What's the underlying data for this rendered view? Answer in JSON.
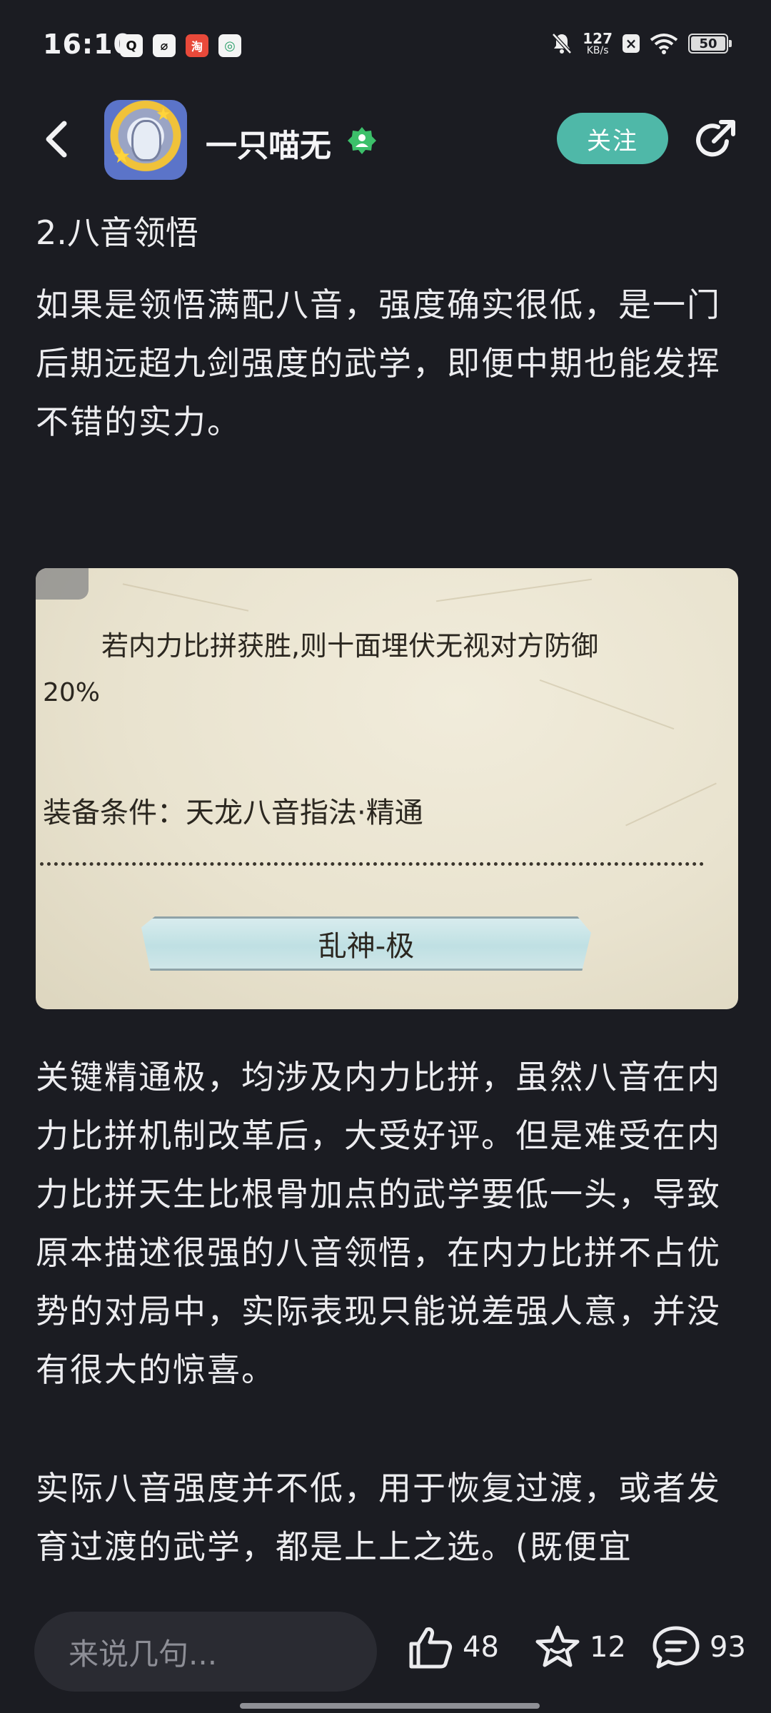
{
  "status_bar": {
    "time": "16:10",
    "apps": [
      {
        "name": "qq-icon",
        "glyph": "Q"
      },
      {
        "name": "leaf-app-icon",
        "glyph": "⌀"
      },
      {
        "name": "taobao-icon",
        "glyph": "淘"
      },
      {
        "name": "green-app-icon",
        "glyph": "◎"
      }
    ],
    "net_speed": "127",
    "net_unit": "KB/s",
    "battery": "50"
  },
  "header": {
    "username": "一只喵无",
    "follow_label": "关注"
  },
  "article": {
    "section_title": "2.八音领悟",
    "paragraph_1": "如果是领悟满配八音，强度确实很低，是一门后期远超九剑强度的武学，即便中期也能发挥不错的实力。",
    "paragraph_2": "关键精通极，均涉及内力比拼，虽然八音在内力比拼机制改革后，大受好评。但是难受在内力比拼天生比根骨加点的武学要低一头，导致原本描述很强的八音领悟，在内力比拼不占优势的对局中，实际表现只能说差强人意，并没有很大的惊喜。",
    "paragraph_3": "实际八音强度并不低，用于恢复过渡，或者发育过渡的武学，都是上上之选。(既便宜"
  },
  "game_image": {
    "effect_text": "若内力比拼获胜,则十面埋伏无视对方防御",
    "percent_text": "20%",
    "requirement_text": "装备条件：天龙八音指法·精通",
    "banner_text": "乱神-极"
  },
  "bottom_bar": {
    "comment_placeholder": "来说几句...",
    "likes": "48",
    "favorites": "12",
    "comments": "93"
  },
  "colors": {
    "background": "#1b1c22",
    "accent": "#4fb8a8",
    "verify_badge": "#3cc06a"
  }
}
